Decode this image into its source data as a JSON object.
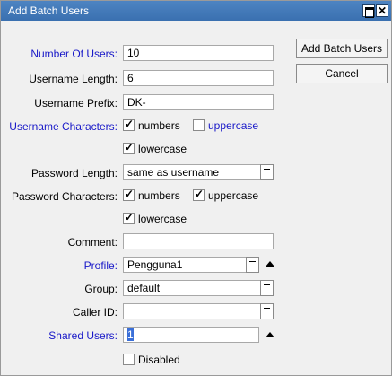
{
  "window": {
    "title": "Add Batch Users"
  },
  "fields": {
    "number_of_users": {
      "label": "Number Of Users:",
      "value": "10"
    },
    "username_length": {
      "label": "Username Length:",
      "value": "6"
    },
    "username_prefix": {
      "label": "Username Prefix:",
      "value": "DK-"
    },
    "username_characters": {
      "label": "Username Characters:",
      "numbers": "numbers",
      "uppercase": "uppercase",
      "lowercase": "lowercase"
    },
    "password_length": {
      "label": "Password Length:",
      "value": "same as username"
    },
    "password_characters": {
      "label": "Password Characters:",
      "numbers": "numbers",
      "uppercase": "uppercase",
      "lowercase": "lowercase"
    },
    "comment": {
      "label": "Comment:",
      "value": ""
    },
    "profile": {
      "label": "Profile:",
      "value": "Pengguna1"
    },
    "group": {
      "label": "Group:",
      "value": "default"
    },
    "caller_id": {
      "label": "Caller ID:",
      "value": ""
    },
    "shared_users": {
      "label": "Shared Users:",
      "value": "1"
    },
    "disabled": {
      "label": "Disabled"
    }
  },
  "buttons": {
    "add": "Add Batch Users",
    "cancel": "Cancel"
  },
  "colors": {
    "titlebar": "#3a70b0",
    "blue_label": "#1818c8"
  }
}
